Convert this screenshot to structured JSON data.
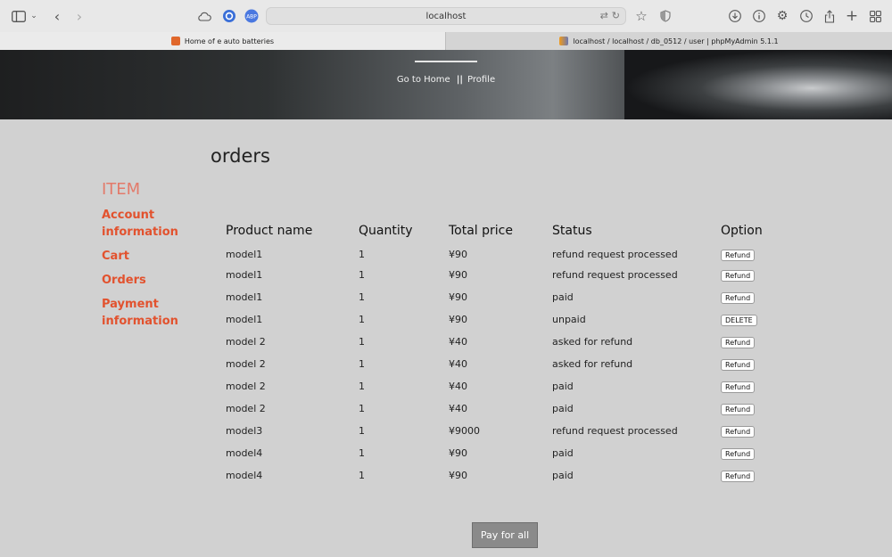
{
  "browser": {
    "url": "localhost",
    "tabs": [
      {
        "label": "Home of e auto batteries"
      },
      {
        "label": "localhost / localhost / db_0512 / user | phpMyAdmin 5.1.1"
      }
    ],
    "extension_badge": "ABP"
  },
  "hero": {
    "nav_home": "Go to Home",
    "nav_separator": "||",
    "nav_profile": "Profile"
  },
  "page": {
    "title": "orders"
  },
  "sidebar": {
    "heading": "ITEM",
    "items": [
      {
        "label": "Account information"
      },
      {
        "label": "Cart"
      },
      {
        "label": "Orders"
      },
      {
        "label": "Payment information"
      }
    ]
  },
  "table": {
    "headers": [
      "Product name",
      "Quantity",
      "Total price",
      "Status",
      "Option"
    ],
    "rows": [
      {
        "product": "model1",
        "quantity": "1",
        "price": "¥90",
        "status": "refund request processed",
        "option": "Refund"
      },
      {
        "product": "model1",
        "quantity": "1",
        "price": "¥90",
        "status": "refund request processed",
        "option": "Refund"
      },
      {
        "product": "model1",
        "quantity": "1",
        "price": "¥90",
        "status": "paid",
        "option": "Refund"
      },
      {
        "product": "model1",
        "quantity": "1",
        "price": "¥90",
        "status": "unpaid",
        "option": "DELETE"
      },
      {
        "product": "model 2",
        "quantity": "1",
        "price": "¥40",
        "status": "asked for refund",
        "option": "Refund"
      },
      {
        "product": "model 2",
        "quantity": "1",
        "price": "¥40",
        "status": "asked for refund",
        "option": "Refund"
      },
      {
        "product": "model 2",
        "quantity": "1",
        "price": "¥40",
        "status": "paid",
        "option": "Refund"
      },
      {
        "product": "model 2",
        "quantity": "1",
        "price": "¥40",
        "status": "paid",
        "option": "Refund"
      },
      {
        "product": "model3",
        "quantity": "1",
        "price": "¥9000",
        "status": "refund request processed",
        "option": "Refund"
      },
      {
        "product": "model4",
        "quantity": "1",
        "price": "¥90",
        "status": "paid",
        "option": "Refund"
      },
      {
        "product": "model4",
        "quantity": "1",
        "price": "¥90",
        "status": "paid",
        "option": "Refund"
      }
    ]
  },
  "pay_button": {
    "label": "Pay for all"
  },
  "colors": {
    "accent": "#e2522e",
    "sidebar_heading": "#e37a6a",
    "background": "#d1d1d1",
    "pay_button": "#8a8a8a"
  }
}
